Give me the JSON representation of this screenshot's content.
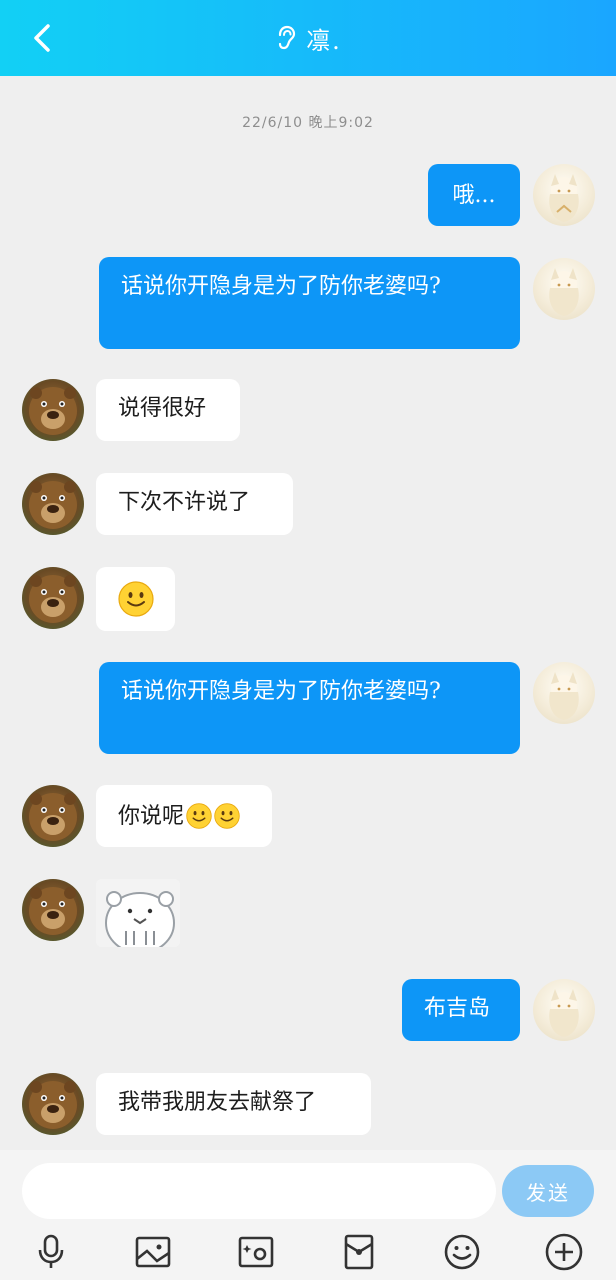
{
  "header": {
    "title": "凛.",
    "back_icon": "chevron-left-icon",
    "ear_icon": "ear-icon"
  },
  "chat": {
    "timestamp": "22/6/10 晚上9:02",
    "messages": [
      {
        "side": "out",
        "type": "text",
        "text": "哦..."
      },
      {
        "side": "out",
        "type": "text",
        "text": "话说你开隐身是为了防你老婆吗?"
      },
      {
        "side": "in",
        "type": "text",
        "text": "说得很好"
      },
      {
        "side": "in",
        "type": "text",
        "text": "下次不许说了"
      },
      {
        "side": "in",
        "type": "emoji",
        "text": "🙂"
      },
      {
        "side": "out",
        "type": "text",
        "text": "话说你开隐身是为了防你老婆吗?"
      },
      {
        "side": "in",
        "type": "text",
        "text": "你说呢",
        "emojis": [
          "🙂",
          "🙂"
        ]
      },
      {
        "side": "in",
        "type": "sticker",
        "text": ""
      },
      {
        "side": "out",
        "type": "text",
        "text": "布吉岛"
      },
      {
        "side": "in",
        "type": "text",
        "text": "我带我朋友去献祭了"
      }
    ]
  },
  "input": {
    "placeholder": "",
    "value": "",
    "send_label": "发送"
  },
  "toolbar": {
    "icons": [
      "microphone-icon",
      "image-icon",
      "camera-icon",
      "red-packet-icon",
      "emoji-icon",
      "plus-circle-icon"
    ]
  },
  "colors": {
    "header_start": "#12d0f5",
    "header_end": "#1aa6ff",
    "outgoing_bubble": "#0d96f7",
    "incoming_bubble": "#ffffff",
    "send_button": "#8cc9f5",
    "background": "#efefef"
  }
}
